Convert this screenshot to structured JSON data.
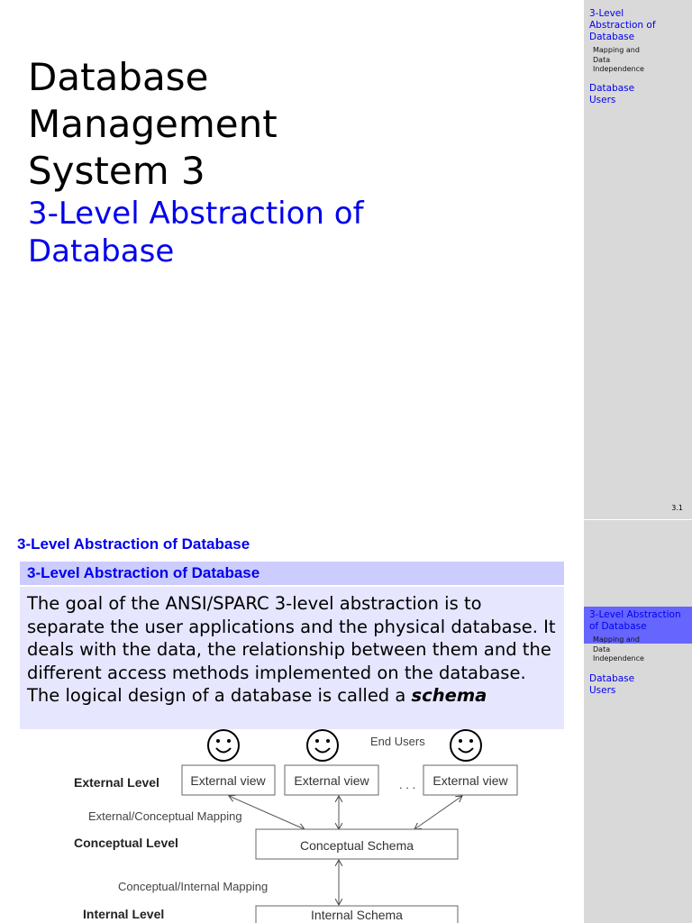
{
  "slide1": {
    "title_lines": [
      "Database",
      "Management",
      "System 3"
    ],
    "subtitle": "3-Level Abstraction of Database",
    "page_number": "3.1",
    "nav": {
      "item1": "3-Level Abstraction of Database",
      "item1_sub": "Mapping and Data Independence",
      "item2": "Database Users"
    }
  },
  "slide2": {
    "heading": "3-Level Abstraction of Database",
    "block_title": "3-Level Abstraction of Database",
    "block_text_pre": "The goal of the ANSI/SPARC 3-level abstraction is to separate the user applications and the physical database. It deals with the data, the relationship between them and the different access methods implemented on the database. The logical design of a database is called a ",
    "block_text_emph": "schema",
    "nav": {
      "item1": "3-Level Abstraction of Database",
      "item1_sub": "Mapping and Data Independence",
      "item2": "Database Users"
    },
    "diagram": {
      "end_users": "End Users",
      "external_level": "External Level",
      "conceptual_level": "Conceptual Level",
      "internal_level": "Internal Level",
      "external_view": "External view",
      "ellipsis": ". . .",
      "ext_conc_mapping": "External/Conceptual  Mapping",
      "conceptual_schema": "Conceptual Schema",
      "conc_int_mapping": "Conceptual/Internal  Mapping",
      "internal_schema": "Internal Schema"
    }
  }
}
